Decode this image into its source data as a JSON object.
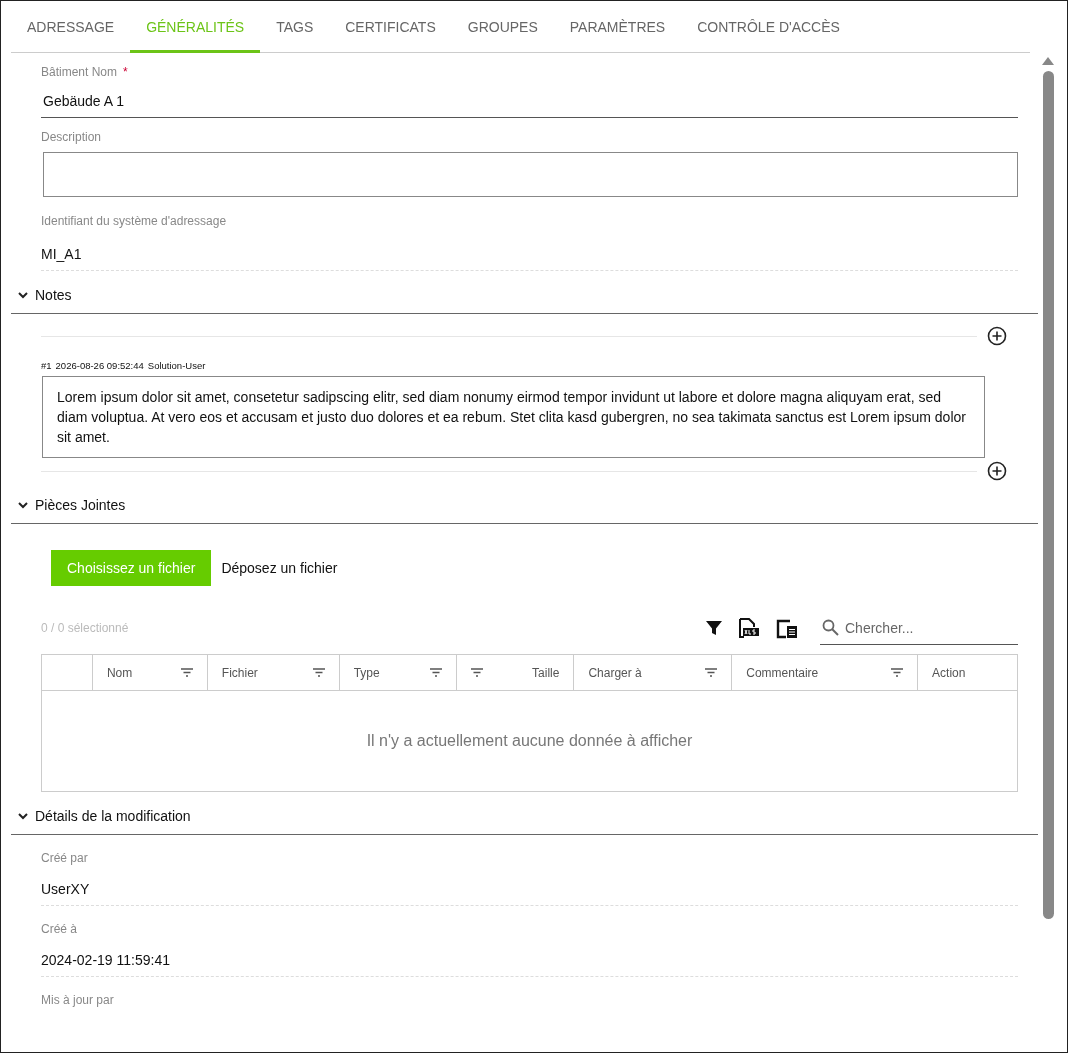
{
  "tabs": [
    {
      "label": "ADRESSAGE",
      "selected": false
    },
    {
      "label": "GÉNÉRALITÉS",
      "selected": true
    },
    {
      "label": "TAGS",
      "selected": false
    },
    {
      "label": "CERTIFICATS",
      "selected": false
    },
    {
      "label": "GROUPES",
      "selected": false
    },
    {
      "label": "PARAMÈTRES",
      "selected": false
    },
    {
      "label": "CONTRÔLE D'ACCÈS",
      "selected": false
    }
  ],
  "fields": [
    {
      "kind": "input",
      "label": "Bâtiment Nom",
      "required_mark": "*",
      "value": "Gebäude A 1"
    },
    {
      "kind": "textarea",
      "label": "Description"
    },
    {
      "kind": "readonly",
      "label": "Identifiant du système d'adressage",
      "value": "MI_A1"
    }
  ],
  "notes": {
    "title": "Notes",
    "expanded": true,
    "entries": [
      {
        "number": "#1",
        "timestamp": "2026-08-26 09:52:44",
        "author": "Solution-User",
        "text": "Lorem ipsum dolor sit amet, consetetur sadipscing elitr, sed diam nonumy eirmod tempor invidunt ut labore et dolore magna aliquyam erat, sed diam voluptua. At vero eos et accusam et justo duo dolores et ea rebum. Stet clita kasd gubergren, no sea takimata sanctus est Lorem ipsum dolor sit amet."
      }
    ]
  },
  "attachments": {
    "title": "Pièces Jointes",
    "expanded": true,
    "upload_button": "Choisissez un fichier",
    "drop_text": "Déposez un fichier",
    "selection_count": "0 / 0 sélectionné",
    "search": {
      "placeholder": "Chercher..."
    },
    "columns": [
      {
        "label": "Nom",
        "filterable": true,
        "kind": "text"
      },
      {
        "label": "Fichier",
        "filterable": true,
        "kind": "text"
      },
      {
        "label": "Type",
        "filterable": true,
        "kind": "text"
      },
      {
        "label": "Taille",
        "filterable": true,
        "kind": "numeric"
      },
      {
        "label": "Charger à",
        "filterable": true,
        "kind": "text"
      },
      {
        "label": "Commentaire",
        "filterable": true,
        "kind": "text"
      },
      {
        "label": "Action",
        "filterable": false,
        "kind": "text"
      }
    ],
    "empty_message": "Il n'y a actuellement aucune donnée à afficher"
  },
  "details": {
    "title": "Détails de la modification",
    "expanded": true,
    "fields": [
      {
        "label": "Créé par",
        "value": "UserXY"
      },
      {
        "label": "Créé à",
        "value": "2024-02-19 11:59:41"
      },
      {
        "label": "Mis à jour par"
      }
    ]
  }
}
